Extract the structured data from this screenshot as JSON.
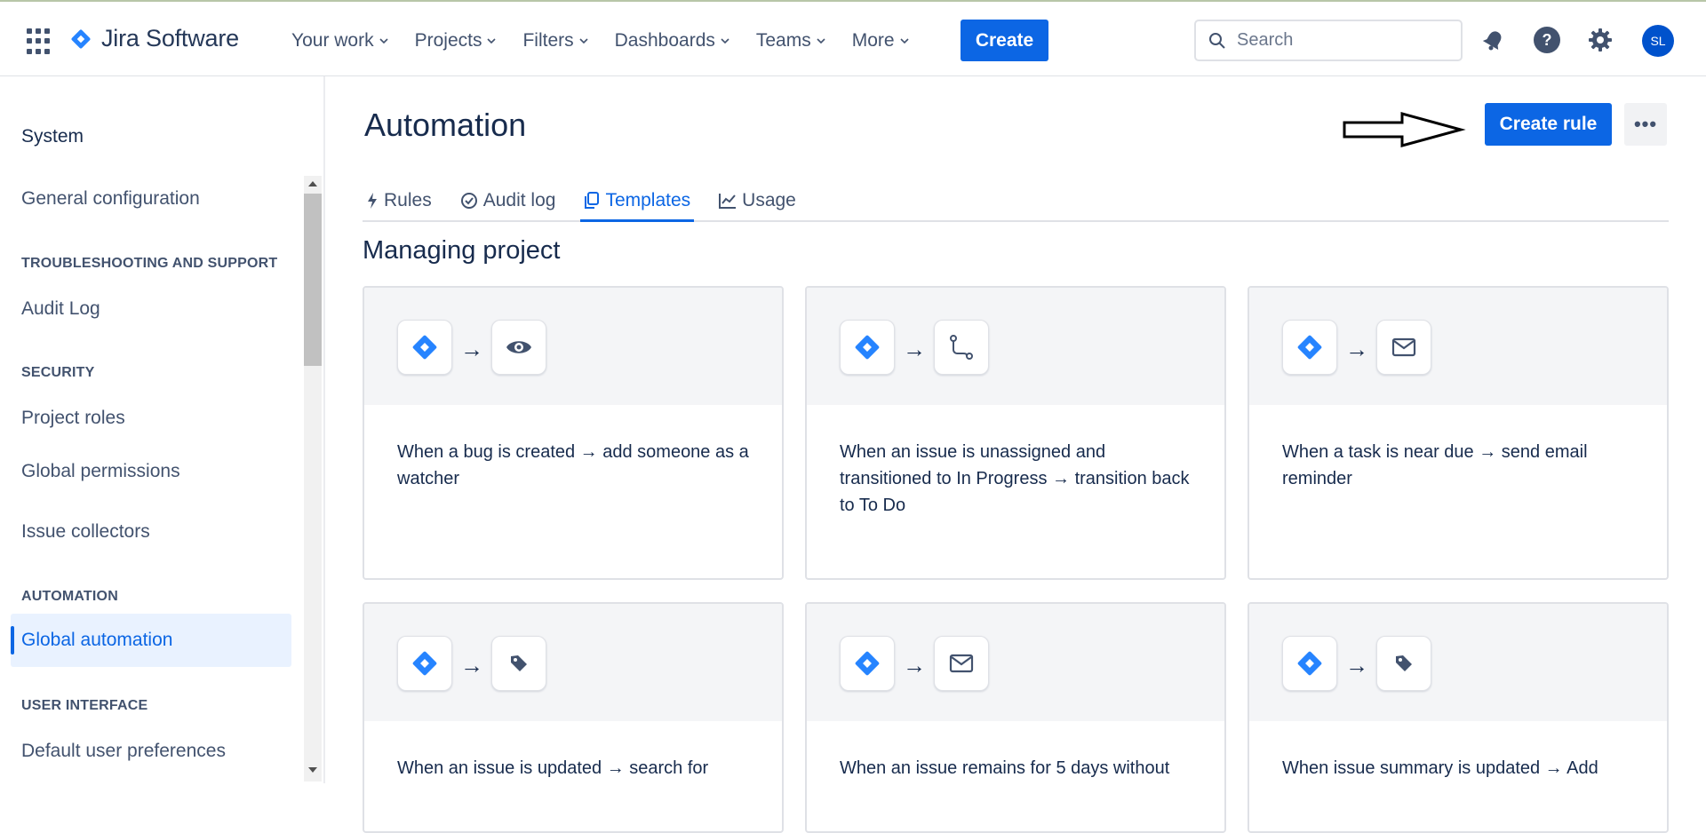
{
  "app": {
    "name": "Jira Software"
  },
  "nav": {
    "items": [
      {
        "label": "Your work"
      },
      {
        "label": "Projects"
      },
      {
        "label": "Filters"
      },
      {
        "label": "Dashboards"
      },
      {
        "label": "Teams"
      },
      {
        "label": "More"
      }
    ],
    "create_label": "Create",
    "search_placeholder": "Search",
    "avatar_initials": "SL"
  },
  "sidebar": {
    "title": "System",
    "general_configuration": "General configuration",
    "sections": {
      "troubleshooting": "TROUBLESHOOTING AND SUPPORT",
      "security": "SECURITY",
      "automation": "AUTOMATION",
      "user_interface": "USER INTERFACE"
    },
    "items": {
      "audit_log": "Audit Log",
      "project_roles": "Project roles",
      "global_permissions": "Global permissions",
      "issue_collectors": "Issue collectors",
      "global_automation": "Global automation",
      "default_user_preferences": "Default user preferences"
    }
  },
  "main": {
    "title": "Automation",
    "create_rule_label": "Create rule",
    "more_label": "•••",
    "tabs": [
      {
        "label": "Rules"
      },
      {
        "label": "Audit log"
      },
      {
        "label": "Templates"
      },
      {
        "label": "Usage"
      }
    ],
    "section_title": "Managing project",
    "arrow_symbol": "→",
    "cards": [
      {
        "text": "When a bug is created → add someone as a watcher",
        "action_icon": "eye-icon"
      },
      {
        "text": "When an issue is unassigned and transitioned to In Progress → transition back to To Do",
        "action_icon": "transition-icon"
      },
      {
        "text": "When a task is near due → send email reminder",
        "action_icon": "mail-icon"
      },
      {
        "text": "When an issue is updated → search for",
        "action_icon": "tag-icon"
      },
      {
        "text": "When an issue remains for 5 days without",
        "action_icon": "mail-icon"
      },
      {
        "text": "When issue summary is updated → Add",
        "action_icon": "tag-icon"
      }
    ]
  },
  "colors": {
    "brand_blue": "#0c66e4",
    "jira_blue": "#2684ff",
    "text": "#172b4d",
    "subtle_text": "#42526e"
  }
}
